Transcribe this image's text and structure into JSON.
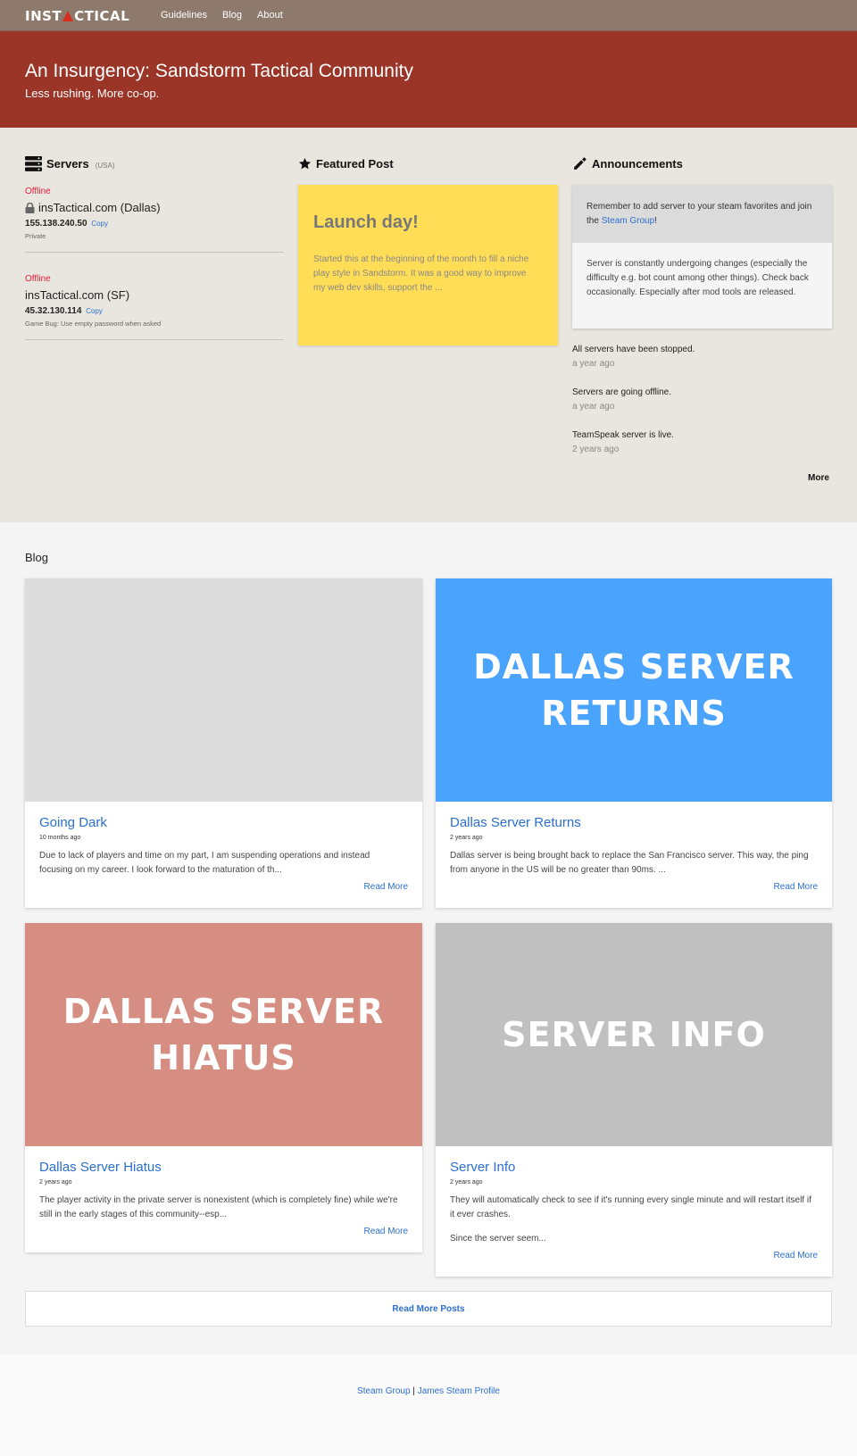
{
  "nav": {
    "brand_left": "INST",
    "brand_right": "CTICAL",
    "links": [
      "Guidelines",
      "Blog",
      "About"
    ]
  },
  "hero": {
    "title": "An Insurgency: Sandstorm Tactical Community",
    "subtitle": "Less rushing. More co-op."
  },
  "servers": {
    "heading": "Servers",
    "region": "(USA)",
    "items": [
      {
        "status": "Offline",
        "name": "insTactical.com (Dallas)",
        "ip": "155.138.240.50",
        "copy": "Copy",
        "note": "Private"
      },
      {
        "status": "Offline",
        "name": "insTactical.com (SF)",
        "ip": "45.32.130.114",
        "copy": "Copy",
        "note": "Game Bug: Use empty password when asked"
      }
    ]
  },
  "featured": {
    "heading": "Featured Post",
    "title": "Launch day!",
    "excerpt": "Started this at the beginning of the month to fill a niche play style in Sandstorm. It was a good way to improve my web dev skills, support the ..."
  },
  "announcements": {
    "heading": "Announcements",
    "pinned_pre": "Remember to add server to your steam favorites and join the ",
    "pinned_link": "Steam Group",
    "pinned_post": "!",
    "notice": "Server is constantly undergoing changes (especially the difficulty e.g. bot count among other things). Check back occasionally. Especially after mod tools are released.",
    "items": [
      {
        "text": "All servers have been stopped.",
        "time": "a year ago"
      },
      {
        "text": "Servers are going offline.",
        "time": "a year ago"
      },
      {
        "text": "TeamSpeak server is live.",
        "time": "2 years ago"
      }
    ],
    "more": "More"
  },
  "blog": {
    "heading": "Blog",
    "posts": [
      {
        "image_text": "",
        "image_color": "#dcdcdc",
        "title": "Going Dark",
        "date": "10 months ago",
        "excerpt": "Due to lack of players and time on my part, I am suspending operations and instead focusing on my career. I look forward to the maturation of th...",
        "excerpt2": "",
        "read_more": "Read More"
      },
      {
        "image_text_1": "DALLAS SERVER",
        "image_text_2": "RETURNS",
        "image_color": "#4aa3fd",
        "title": "Dallas Server Returns",
        "date": "2 years ago",
        "excerpt": "Dallas server is being brought back to replace the San Francisco server. This way, the ping from anyone in the US will be no greater than 90ms. ...",
        "read_more": "Read More"
      },
      {
        "image_text_1": "DALLAS SERVER",
        "image_text_2": "HIATUS",
        "image_color": "#d68e83",
        "title": "Dallas Server Hiatus",
        "date": "2 years ago",
        "excerpt": "The player activity in the private server is nonexistent (which is completely fine) while we're still in the early stages of this community--esp...",
        "read_more": "Read More"
      },
      {
        "image_text_1": "SERVER INFO",
        "image_color": "#c0c0c0",
        "title": "Server Info",
        "date": "2 years ago",
        "excerpt": "They will automatically check to see if it's running every single minute and will restart itself if it ever crashes.",
        "excerpt2": "Since the server seem...",
        "read_more": "Read More"
      }
    ],
    "more_posts": "Read More Posts"
  },
  "footer": {
    "link1": "Steam Group",
    "separator": "|",
    "link2": "James Steam Profile"
  }
}
